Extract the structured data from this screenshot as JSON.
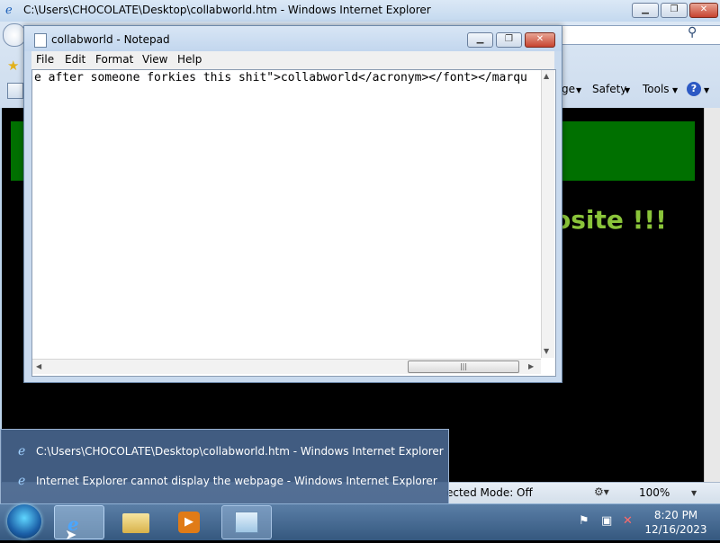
{
  "ie": {
    "title": "C:\\Users\\CHOCOLATE\\Desktop\\collabworld.htm - Windows Internet Explorer",
    "commands": {
      "page_partial": "ge",
      "safety": "Safety",
      "tools": "Tools"
    },
    "content_text": "osite !!!",
    "status": {
      "protected_mode": "ected Mode: Off",
      "zoom": "100%"
    }
  },
  "notepad": {
    "title": "collabworld - Notepad",
    "menu": [
      "File",
      "Edit",
      "Format",
      "View",
      "Help"
    ],
    "text": "e after someone forkies this shit\">collabworld</acronym></font></marqu"
  },
  "thumbnails": [
    "C:\\Users\\CHOCOLATE\\Desktop\\collabworld.htm - Windows Internet Explorer",
    "Internet Explorer cannot display the webpage - Windows Internet Explorer"
  ],
  "taskbar": {
    "time": "8:20 PM",
    "date": "12/16/2023"
  },
  "icons": {
    "ie": "internet-explorer-icon",
    "explorer": "folder-icon",
    "media": "media-player-icon",
    "notepad": "notepad-icon"
  }
}
